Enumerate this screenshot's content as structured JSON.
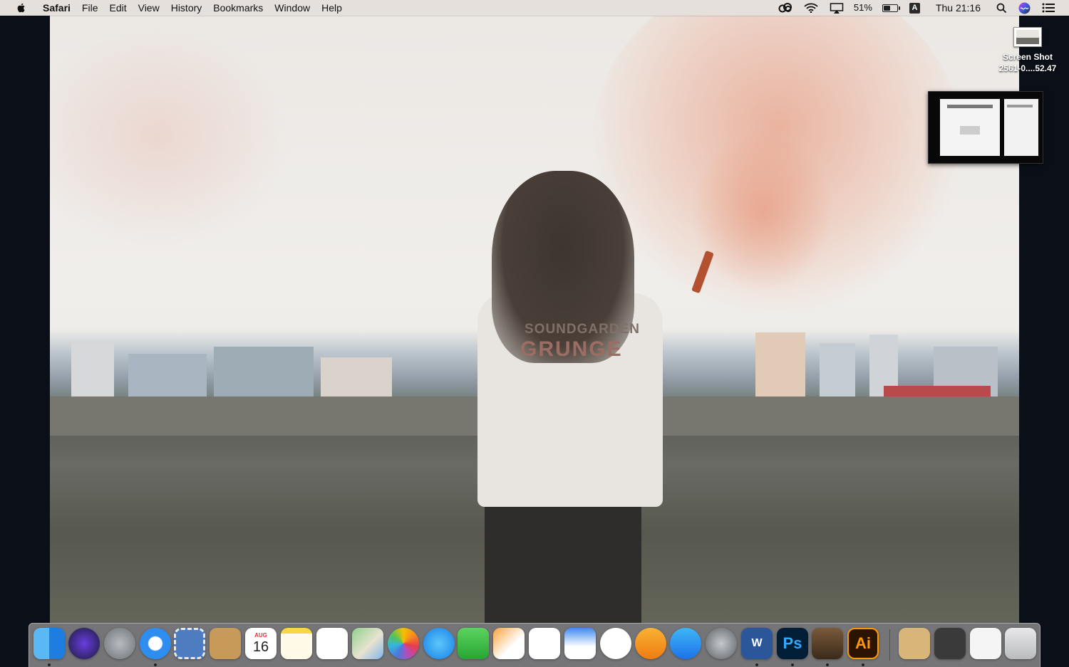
{
  "menubar": {
    "app_name": "Safari",
    "menus": [
      "File",
      "Edit",
      "View",
      "History",
      "Bookmarks",
      "Window",
      "Help"
    ],
    "status": {
      "battery_percent": "51%",
      "battery_level": 0.51,
      "input_source": "A",
      "clock": "Thu 21:16"
    }
  },
  "wallpaper": {
    "shirt_text_top": "SOUNDGARDEN",
    "shirt_text_bottom": "GRUNGE"
  },
  "desktop": {
    "file_name": "Screen Shot\n2561-0....52.47"
  },
  "dock": {
    "apps": [
      {
        "name": "Finder",
        "icon": "finder-icon",
        "running": true
      },
      {
        "name": "Siri",
        "icon": "siri-icon",
        "running": false
      },
      {
        "name": "Launchpad",
        "icon": "rocket-icon",
        "running": false
      },
      {
        "name": "Safari",
        "icon": "compass-icon",
        "running": true
      },
      {
        "name": "Mail",
        "icon": "stamp-icon",
        "running": false
      },
      {
        "name": "Contacts",
        "icon": "contacts-book-icon",
        "running": false
      },
      {
        "name": "Calendar",
        "icon": "calendar-icon",
        "running": false,
        "month": "AUG",
        "day": "16"
      },
      {
        "name": "Notes",
        "icon": "notepad-icon",
        "running": false
      },
      {
        "name": "Reminders",
        "icon": "checklist-icon",
        "running": false
      },
      {
        "name": "Maps",
        "icon": "map-icon",
        "running": false
      },
      {
        "name": "Photos",
        "icon": "pinwheel-icon",
        "running": false
      },
      {
        "name": "Messages",
        "icon": "chat-bubble-icon",
        "running": false
      },
      {
        "name": "FaceTime",
        "icon": "video-camera-icon",
        "running": false
      },
      {
        "name": "Pages",
        "icon": "pen-paper-icon",
        "running": false
      },
      {
        "name": "Numbers",
        "icon": "bar-chart-icon",
        "running": false
      },
      {
        "name": "Keynote",
        "icon": "podium-icon",
        "running": false
      },
      {
        "name": "iTunes",
        "icon": "music-note-icon",
        "running": false
      },
      {
        "name": "iBooks",
        "icon": "open-book-icon",
        "running": false
      },
      {
        "name": "App Store",
        "icon": "app-store-icon",
        "running": false
      },
      {
        "name": "System Preferences",
        "icon": "gear-icon",
        "running": false
      },
      {
        "name": "Microsoft Word",
        "icon": "word-icon",
        "running": true,
        "label": "W"
      },
      {
        "name": "Adobe Photoshop",
        "icon": "photoshop-icon",
        "running": true,
        "label": "Ps"
      },
      {
        "name": "GarageBand",
        "icon": "guitar-icon",
        "running": true
      },
      {
        "name": "Adobe Illustrator",
        "icon": "illustrator-icon",
        "running": true,
        "label": "Ai"
      },
      {
        "name": "Utility",
        "icon": "recycle-box-icon",
        "running": false
      },
      {
        "name": "Downloads",
        "icon": "downloads-stack-icon",
        "running": false
      },
      {
        "name": "Documents",
        "icon": "documents-stack-icon",
        "running": false
      },
      {
        "name": "Trash",
        "icon": "trash-icon",
        "running": false
      }
    ]
  },
  "colors": {
    "menubar_bg": "#f6f0ec",
    "photoshop": "#001e36",
    "photoshop_text": "#31a8ff",
    "illustrator": "#2b1500",
    "illustrator_text": "#ff9a00",
    "word": "#2b579a"
  }
}
